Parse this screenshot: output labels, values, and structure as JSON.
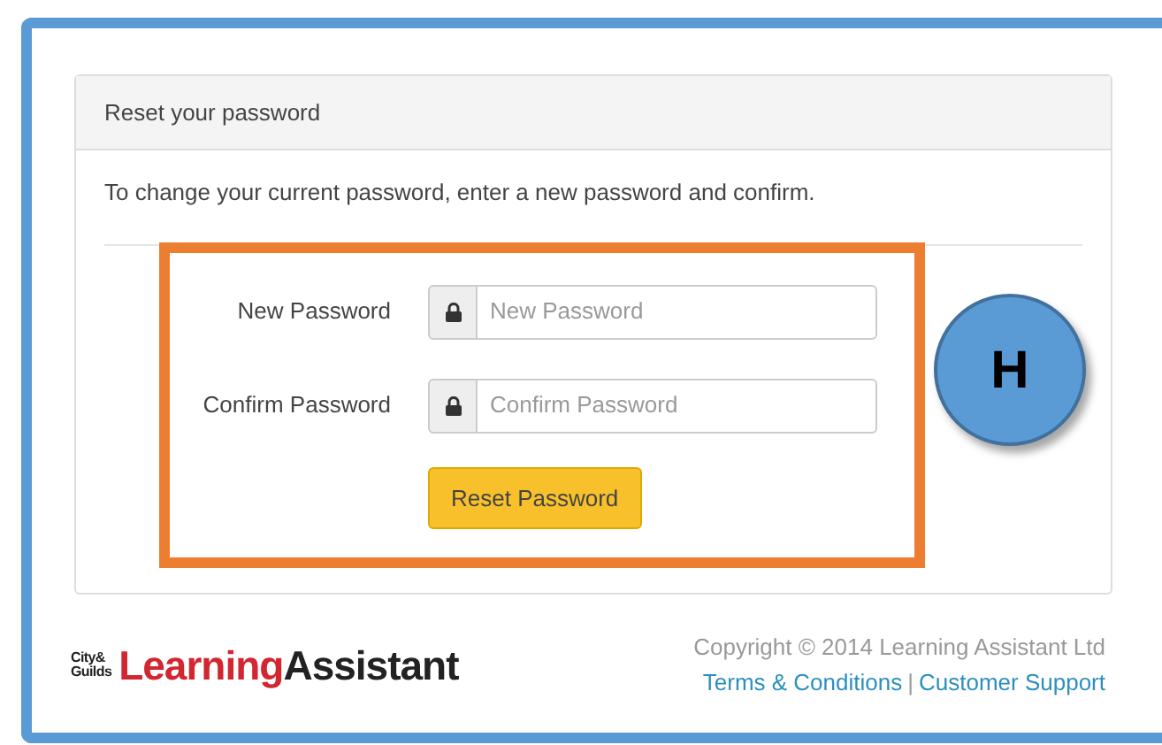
{
  "panel": {
    "title": "Reset your password",
    "instructions": "To change your current password, enter a new password and confirm.",
    "fields": [
      {
        "label": "New Password",
        "placeholder": "New Password"
      },
      {
        "label": "Confirm Password",
        "placeholder": "Confirm Password"
      }
    ],
    "submit": "Reset Password"
  },
  "callout": {
    "letter": "H"
  },
  "footer": {
    "logo": {
      "mark_top": "City&",
      "mark_bottom": "Guilds",
      "word_1": "Learning",
      "word_2": "Assistant"
    },
    "copyright": "Copyright © 2014 Learning Assistant Ltd",
    "links": [
      "Terms & Conditions",
      "Customer Support"
    ],
    "separator": "|"
  }
}
